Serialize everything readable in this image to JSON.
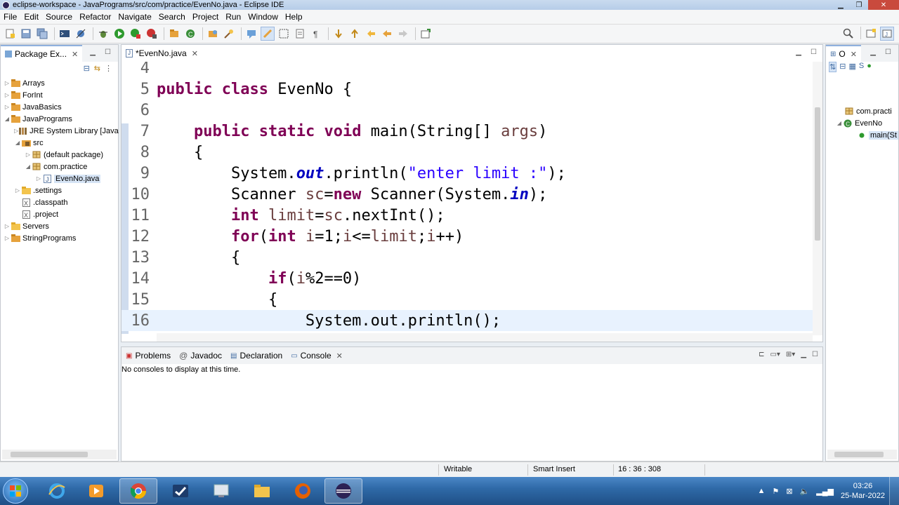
{
  "window": {
    "title": "eclipse-workspace - JavaPrograms/src/com/practice/EvenNo.java - Eclipse IDE"
  },
  "menu": [
    "File",
    "Edit",
    "Source",
    "Refactor",
    "Navigate",
    "Search",
    "Project",
    "Run",
    "Window",
    "Help"
  ],
  "package_explorer": {
    "tab_label": "Package Ex...",
    "tree": [
      {
        "label": "Arrays",
        "depth": 0,
        "arrow": "▷",
        "icon": "project-icon"
      },
      {
        "label": "ForInt",
        "depth": 0,
        "arrow": "▷",
        "icon": "project-icon"
      },
      {
        "label": "JavaBasics",
        "depth": 0,
        "arrow": "▷",
        "icon": "project-icon"
      },
      {
        "label": "JavaPrograms",
        "depth": 0,
        "arrow": "◢",
        "icon": "project-icon"
      },
      {
        "label": "JRE System Library [Java",
        "depth": 1,
        "arrow": "▷",
        "icon": "library-icon"
      },
      {
        "label": "src",
        "depth": 1,
        "arrow": "◢",
        "icon": "source-folder-icon"
      },
      {
        "label": "(default package)",
        "depth": 2,
        "arrow": "▷",
        "icon": "package-icon"
      },
      {
        "label": "com.practice",
        "depth": 2,
        "arrow": "◢",
        "icon": "package-icon"
      },
      {
        "label": "EvenNo.java",
        "depth": 3,
        "arrow": "▷",
        "icon": "java-file-icon",
        "selected": true
      },
      {
        "label": ".settings",
        "depth": 1,
        "arrow": "▷",
        "icon": "folder-icon"
      },
      {
        "label": ".classpath",
        "depth": 1,
        "arrow": "",
        "icon": "xml-file-icon"
      },
      {
        "label": ".project",
        "depth": 1,
        "arrow": "",
        "icon": "xml-file-icon"
      },
      {
        "label": "Servers",
        "depth": 0,
        "arrow": "▷",
        "icon": "folder-icon"
      },
      {
        "label": "StringPrograms",
        "depth": 0,
        "arrow": "▷",
        "icon": "project-icon"
      }
    ]
  },
  "editor": {
    "tab_label": "*EvenNo.java",
    "lines": [
      {
        "n": "4",
        "html": ""
      },
      {
        "n": "5",
        "html": "<span class='kw'>public</span> <span class='kw'>class</span> EvenNo {"
      },
      {
        "n": "6",
        "html": ""
      },
      {
        "n": "7",
        "html": "    <span class='kw'>public</span> <span class='kw'>static</span> <span class='kw'>void</span> main(String[] <span class='var'>args</span>)"
      },
      {
        "n": "8",
        "html": "    {"
      },
      {
        "n": "9",
        "html": "        System.<span class='fld'>out</span>.println(<span class='str'>\"enter limit :\"</span>);"
      },
      {
        "n": "10",
        "html": "        Scanner <span class='var'>sc</span>=<span class='kw'>new</span> Scanner(System.<span class='fld'>in</span>);"
      },
      {
        "n": "11",
        "html": "        <span class='kw'>int</span> <span class='var'>limit</span>=<span class='var'>sc</span>.nextInt();"
      },
      {
        "n": "12",
        "html": "        <span class='kw'>for</span>(<span class='kw'>int</span> <span class='var'>i</span>=1;<span class='var'>i</span>&lt;=<span class='var'>limit</span>;<span class='var'>i</span>++)"
      },
      {
        "n": "13",
        "html": "        {"
      },
      {
        "n": "14",
        "html": "            <span class='kw'>if</span>(<span class='var'>i</span>%2==0)"
      },
      {
        "n": "15",
        "html": "            {"
      },
      {
        "n": "16",
        "html": "                System.out.println();",
        "current": true
      }
    ]
  },
  "console": {
    "tabs": [
      "Problems",
      "Javadoc",
      "Declaration",
      "Console"
    ],
    "active_tab": "Console",
    "message": "No consoles to display at this time."
  },
  "outline": {
    "tab_label": "O",
    "tree": [
      {
        "label": "com.practi",
        "icon": "package-icon"
      },
      {
        "label": "EvenNo",
        "icon": "class-icon"
      },
      {
        "label": "main(St",
        "icon": "method-icon",
        "selected": true
      }
    ]
  },
  "status": {
    "writable": "Writable",
    "insert_mode": "Smart Insert",
    "position": "16 : 36 : 308"
  },
  "taskbar": {
    "time": "03:26",
    "date": "25-Mar-2022"
  }
}
